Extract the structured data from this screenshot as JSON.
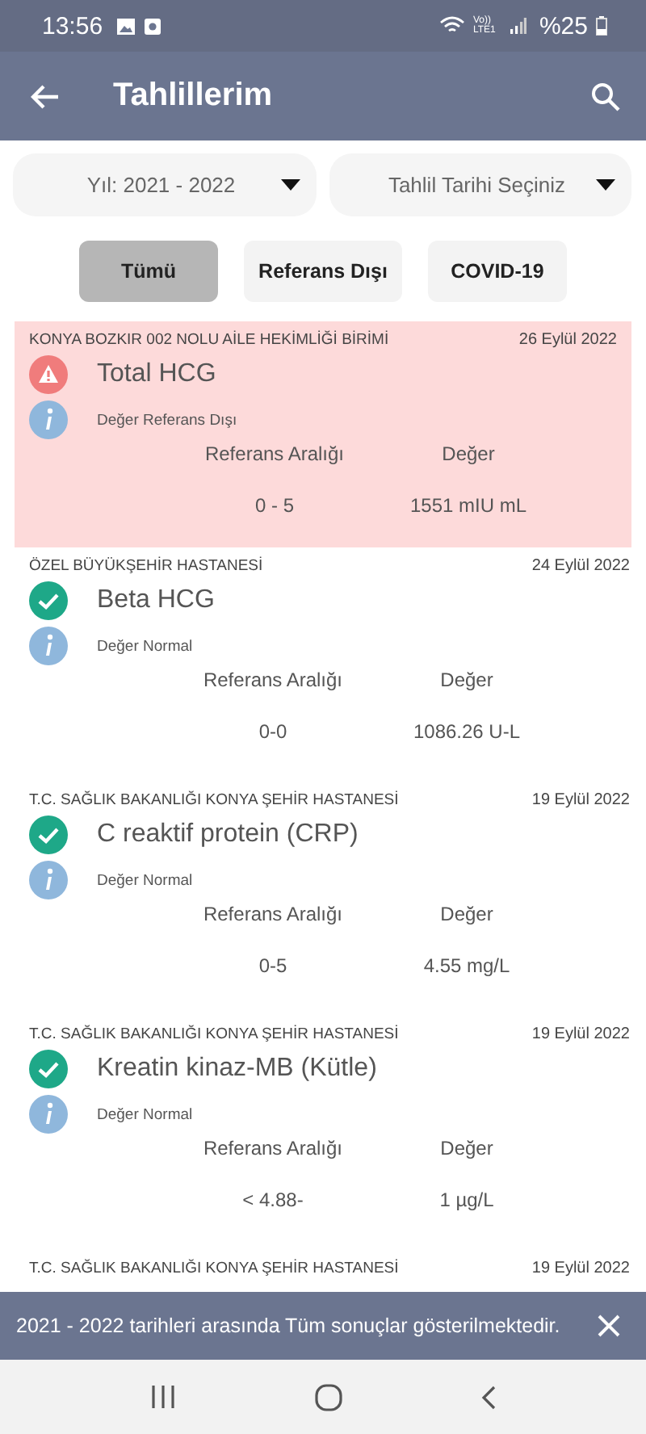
{
  "status_bar": {
    "time": "13:56",
    "network": "Vo)) LTE1",
    "battery": "%25"
  },
  "app_bar": {
    "title": "Tahlillerim"
  },
  "filters": [
    {
      "label": "Yıl: 2021 - 2022"
    },
    {
      "label": "Tahlil Tarihi Seçiniz"
    }
  ],
  "chips": [
    {
      "label": "Tümü",
      "selected": true
    },
    {
      "label": "Referans Dışı",
      "selected": false
    },
    {
      "label": "COVID-19",
      "selected": false
    }
  ],
  "results": [
    {
      "hospital": "KONYA BOZKIR 002 NOLU AİLE HEKİMLİĞİ BİRİMİ",
      "date": "26 Eylül 2022",
      "test": "Total HCG",
      "status": "Değer Referans Dışı",
      "kind": "abnormal",
      "range_label": "Referans Aralığı",
      "value_label": "Değer",
      "range": "0 - 5",
      "value": "1551 mIU mL"
    },
    {
      "hospital": "ÖZEL BÜYÜKŞEHİR HASTANESİ",
      "date": "24 Eylül 2022",
      "test": "Beta HCG",
      "status": "Değer Normal",
      "kind": "normal",
      "range_label": "Referans Aralığı",
      "value_label": "Değer",
      "range": "0-0",
      "value": "1086.26 U-L"
    },
    {
      "hospital": "T.C. SAĞLIK BAKANLIĞI KONYA ŞEHİR HASTANESİ",
      "date": "19 Eylül 2022",
      "test": "C reaktif protein (CRP)",
      "status": "Değer Normal",
      "kind": "normal",
      "range_label": "Referans Aralığı",
      "value_label": "Değer",
      "range": "0-5",
      "value": "4.55 mg/L"
    },
    {
      "hospital": "T.C. SAĞLIK BAKANLIĞI KONYA ŞEHİR HASTANESİ",
      "date": "19 Eylül 2022",
      "test": "Kreatin kinaz-MB (Kütle)",
      "status": "Değer Normal",
      "kind": "normal",
      "range_label": "Referans Aralığı",
      "value_label": "Değer",
      "range": "< 4.88-",
      "value": "1 µg/L"
    },
    {
      "hospital": "T.C. SAĞLIK BAKANLIĞI KONYA ŞEHİR HASTANESİ",
      "date": "19 Eylül 2022",
      "kind": "header"
    }
  ],
  "snackbar": {
    "message": "2021 - 2022 tarihleri arasında Tüm sonuçlar gösterilmektedir."
  }
}
